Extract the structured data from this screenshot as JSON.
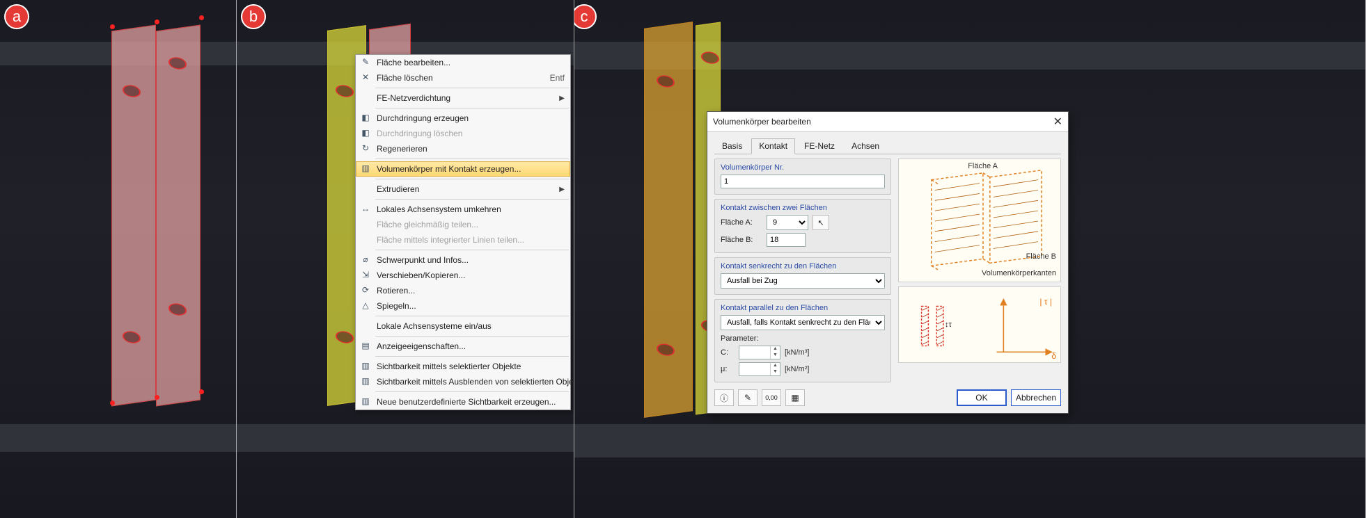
{
  "badges": {
    "a": "a",
    "b": "b",
    "c": "c"
  },
  "context_menu": {
    "items": [
      {
        "icon": "✎",
        "label": "Fläche bearbeiten...",
        "disabled": false
      },
      {
        "icon": "✕",
        "label": "Fläche löschen",
        "shortcut": "Entf",
        "disabled": false
      },
      {
        "sep": true
      },
      {
        "icon": "",
        "label": "FE-Netzverdichtung",
        "submenu": true
      },
      {
        "sep": true
      },
      {
        "icon": "◧",
        "label": "Durchdringung erzeugen"
      },
      {
        "icon": "◧",
        "label": "Durchdringung löschen",
        "disabled": true
      },
      {
        "icon": "↻",
        "label": "Regenerieren"
      },
      {
        "sep": true
      },
      {
        "icon": "▥",
        "label": "Volumenkörper mit Kontakt erzeugen...",
        "highlight": true
      },
      {
        "sep": true
      },
      {
        "icon": "",
        "label": "Extrudieren",
        "submenu": true
      },
      {
        "sep": true
      },
      {
        "icon": "↔",
        "label": "Lokales Achsensystem umkehren"
      },
      {
        "icon": "",
        "label": "Fläche gleichmäßig teilen...",
        "disabled": true
      },
      {
        "icon": "",
        "label": "Fläche mittels integrierter Linien teilen...",
        "disabled": true
      },
      {
        "sep": true
      },
      {
        "icon": "⌀",
        "label": "Schwerpunkt und Infos..."
      },
      {
        "icon": "⇲",
        "label": "Verschieben/Kopieren..."
      },
      {
        "icon": "⟳",
        "label": "Rotieren..."
      },
      {
        "icon": "△",
        "label": "Spiegeln..."
      },
      {
        "sep": true
      },
      {
        "icon": "",
        "label": "Lokale Achsensysteme ein/aus"
      },
      {
        "sep": true
      },
      {
        "icon": "▤",
        "label": "Anzeigeeigenschaften..."
      },
      {
        "sep": true
      },
      {
        "icon": "▥",
        "label": "Sichtbarkeit mittels selektierter Objekte"
      },
      {
        "icon": "▥",
        "label": "Sichtbarkeit mittels Ausblenden von selektierten Objekten"
      },
      {
        "sep": true
      },
      {
        "icon": "▥",
        "label": "Neue benutzerdefinierte Sichtbarkeit erzeugen..."
      }
    ]
  },
  "dialog": {
    "title": "Volumenkörper bearbeiten",
    "tabs": [
      "Basis",
      "Kontakt",
      "FE-Netz",
      "Achsen"
    ],
    "active_tab": "Kontakt",
    "group_nr_title": "Volumenkörper Nr.",
    "nr_value": "1",
    "group_faces_title": "Kontakt zwischen zwei Flächen",
    "face_a_label": "Fläche A:",
    "face_a_value": "9",
    "face_b_label": "Fläche B:",
    "face_b_value": "18",
    "group_perp_title": "Kontakt senkrecht zu den Flächen",
    "perp_value": "Ausfall bei Zug",
    "group_par_title": "Kontakt parallel zu den Flächen",
    "par_value": "Ausfall, falls Kontakt senkrecht zu den Flächen nicht wirkt",
    "param_label": "Parameter:",
    "param_c_label": "C:",
    "param_c_unit": "[kN/m³]",
    "param_mu_label": "μ:",
    "param_mu_unit": "[kN/m²]",
    "illus_labels": {
      "flA": "Fläche A",
      "flB": "Fläche B",
      "edges": "Volumenkörperkanten"
    },
    "illus2_labels": {
      "tau": "| τ |",
      "delta": "δ",
      "sym": "↕τ"
    },
    "ok": "OK",
    "cancel": "Abbrechen"
  }
}
